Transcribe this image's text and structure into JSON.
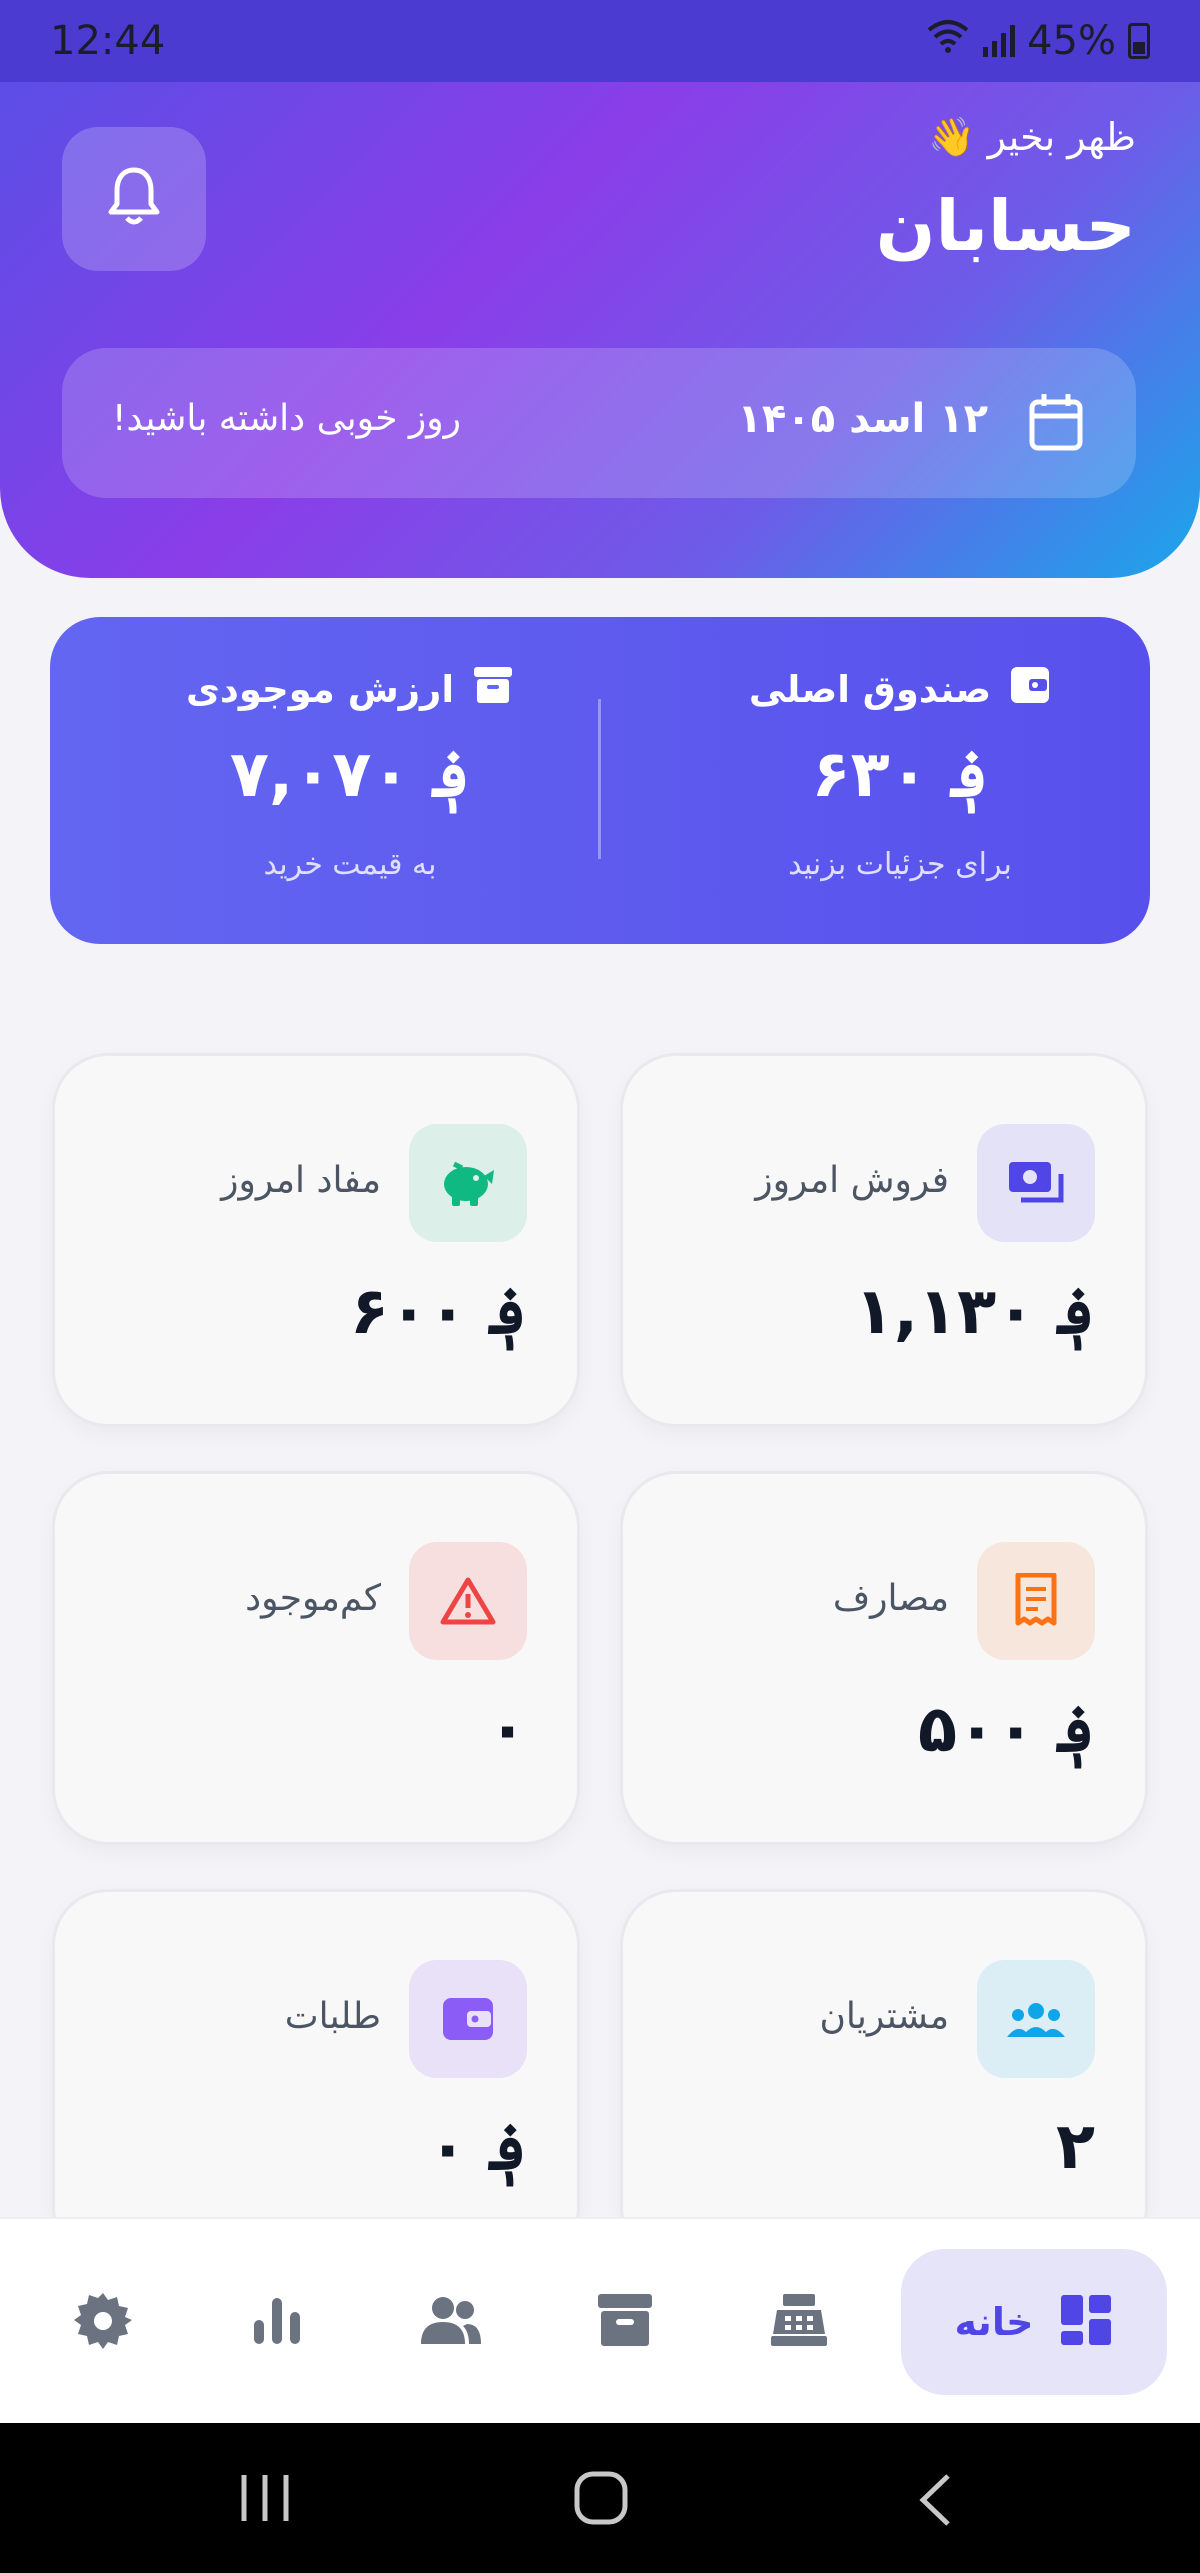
{
  "status_bar": {
    "time": "12:44",
    "battery": "45%"
  },
  "header": {
    "greeting": "ظهر بخیر 👋",
    "title": "حسابان",
    "date": "۱۲ اسد ۱۴۰۵",
    "wish": "روز خوبی داشته باشید!"
  },
  "summary": {
    "main_fund": {
      "label": "صندوق اصلی",
      "value": "؋ ۶۳۰",
      "sub": "برای جزئیات بزنید"
    },
    "inventory_value": {
      "label": "ارزش موجودی",
      "value": "؋ ۷,۰۷۰",
      "sub": "به قیمت خرید"
    }
  },
  "cards": [
    {
      "label": "فروش امروز",
      "value": "؋ ۱,۱۳۰",
      "icon": "money-bill-icon",
      "color": "#4f46e5",
      "bg": "#e4e2f7"
    },
    {
      "label": "مفاد امروز",
      "value": "؋ ۶۰۰",
      "icon": "piggy-bank-icon",
      "color": "#10b981",
      "bg": "#dcefe8"
    },
    {
      "label": "مصارف",
      "value": "؋ ۵۰۰",
      "icon": "receipt-icon",
      "color": "#f97316",
      "bg": "#f7e6dc"
    },
    {
      "label": "کم‌موجود",
      "value": "۰",
      "icon": "warning-icon",
      "color": "#ef4444",
      "bg": "#f7dfe0"
    },
    {
      "label": "مشتریان",
      "value": "۲",
      "icon": "users-icon",
      "color": "#0ea5e9",
      "bg": "#dbeef6"
    },
    {
      "label": "طلبات",
      "value": "؋ ۰",
      "icon": "wallet-icon",
      "color": "#8b5cf6",
      "bg": "#e8e1f7"
    }
  ],
  "nav": {
    "active_label": "خانه",
    "items": [
      "dashboard-icon",
      "cash-register-icon",
      "box-icon",
      "users-icon",
      "chart-icon",
      "settings-icon"
    ]
  },
  "colors": {
    "accent": "#4f46e5",
    "nav_icon": "#6b7280"
  }
}
